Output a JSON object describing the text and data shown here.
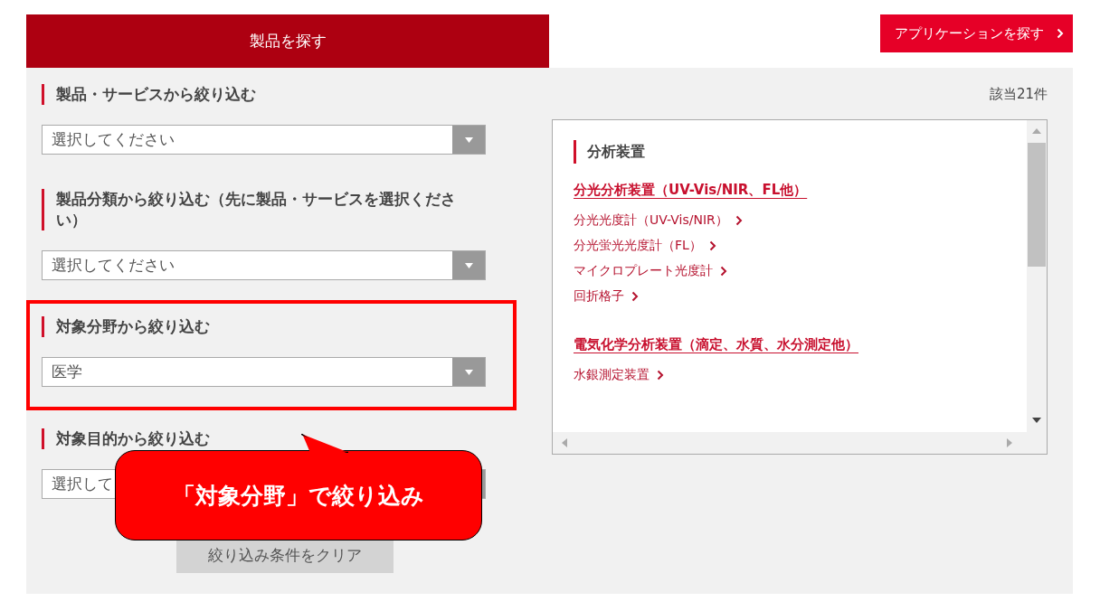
{
  "tabs": [
    {
      "label": "製品を探す",
      "selected": true
    },
    {
      "label": "アプリケーションを探す",
      "selected": false
    }
  ],
  "filters": [
    {
      "heading": "製品・サービスから絞り込む",
      "value": "選択してください",
      "highlighted": false
    },
    {
      "heading": "製品分類から絞り込む（先に製品・サービスを選択ください）",
      "value": "選択してください",
      "highlighted": false
    },
    {
      "heading": "対象分野から絞り込む",
      "value": "医学",
      "highlighted": true
    },
    {
      "heading": "対象目的から絞り込む",
      "value": "選択して",
      "highlighted": false
    }
  ],
  "clear_button": "絞り込み条件をクリア",
  "result_count": "該当21件",
  "results": [
    {
      "category": "分析装置",
      "groups": [
        {
          "title": "分光分析装置（UV-Vis/NIR、FL他）",
          "items": [
            "分光光度計（UV-Vis/NIR）",
            "分光蛍光光度計（FL）",
            "マイクロプレート光度計",
            "回折格子"
          ]
        },
        {
          "title": "電気化学分析装置（滴定、水質、水分測定他）",
          "items": [
            "水銀測定装置"
          ]
        }
      ]
    }
  ],
  "callout": {
    "text": "「対象分野」で絞り込み"
  }
}
